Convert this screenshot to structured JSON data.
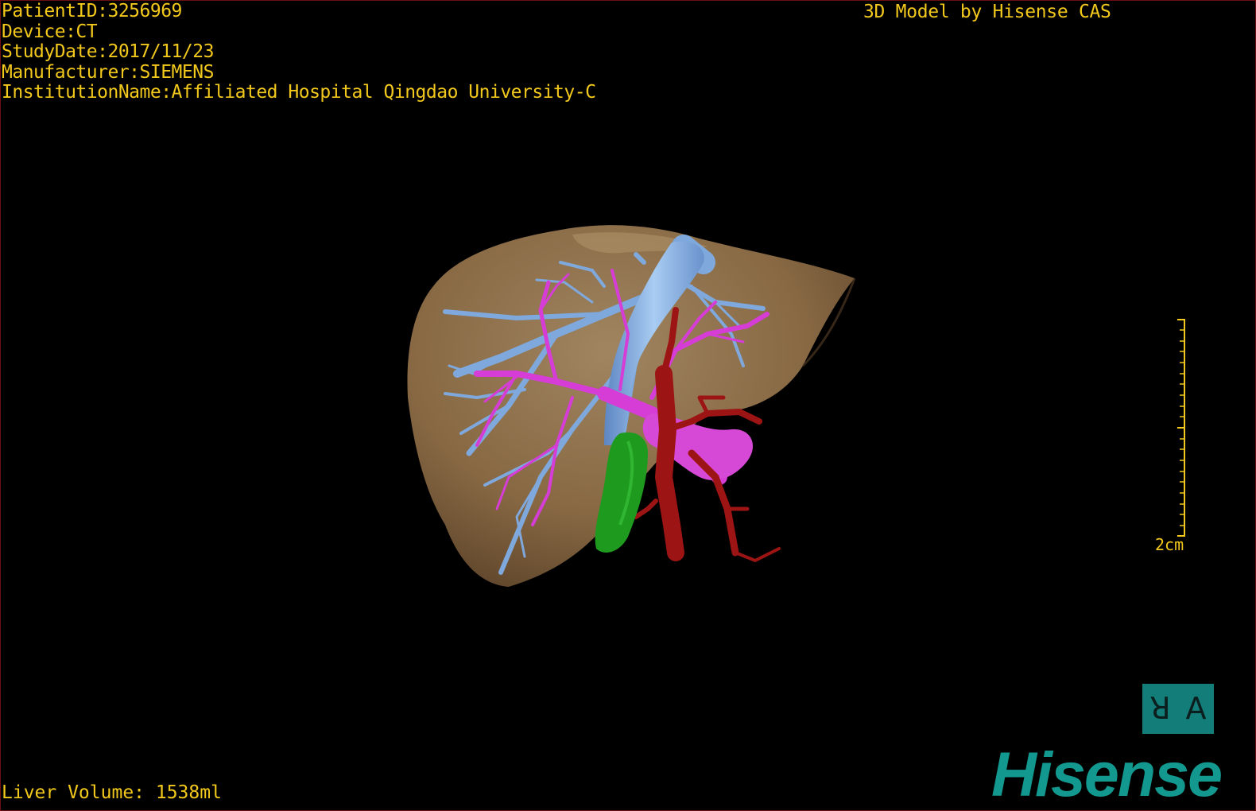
{
  "overlay": {
    "patient_id": "PatientID:3256969",
    "device": "Device:CT",
    "study_date": "StudyDate:2017/11/23",
    "manufacturer": "Manufacturer:SIEMENS",
    "institution": "InstitutionName:Affiliated Hospital Qingdao University-C"
  },
  "model_credit": "3D Model by Hisense CAS",
  "liver_volume": "Liver Volume: 1538ml",
  "scale_bar": {
    "label": "2cm"
  },
  "view_toggle": {
    "left_label": "ꓤ",
    "right_label": "A"
  },
  "logo": {
    "text": "Hisense"
  },
  "colors": {
    "text": "#f2c81c",
    "liver": "#8a6a45",
    "hepatic_vein": "#7fa8dc",
    "portal_vein": "#d63cd6",
    "artery": "#9c1414",
    "gallbladder": "#1e9a1e",
    "teal": "#137d7a"
  },
  "icons": [
    "orientation-toggle-icon",
    "hisense-logo"
  ]
}
